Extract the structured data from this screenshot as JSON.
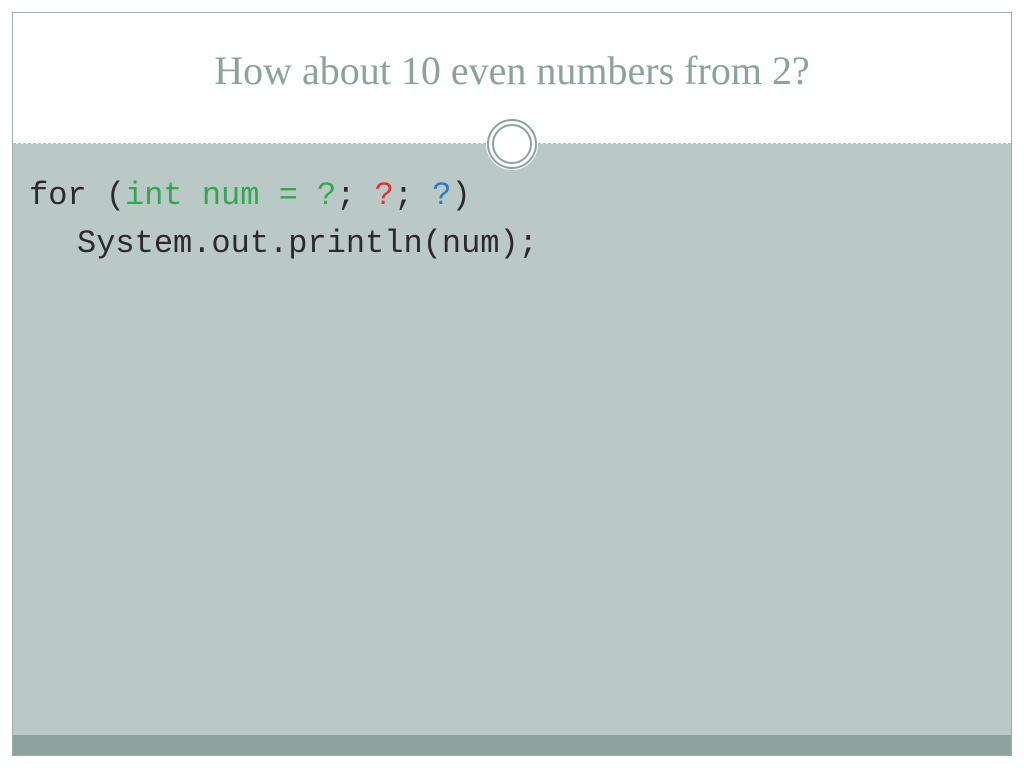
{
  "title": "How about 10 even numbers from 2?",
  "code": {
    "line1": {
      "p1": "for (",
      "p2": "int num = ?",
      "p3": "; ",
      "p4": "?",
      "p5": "; ",
      "p6": "?",
      "p7": ")"
    },
    "line2": "System.out.println(num);"
  }
}
